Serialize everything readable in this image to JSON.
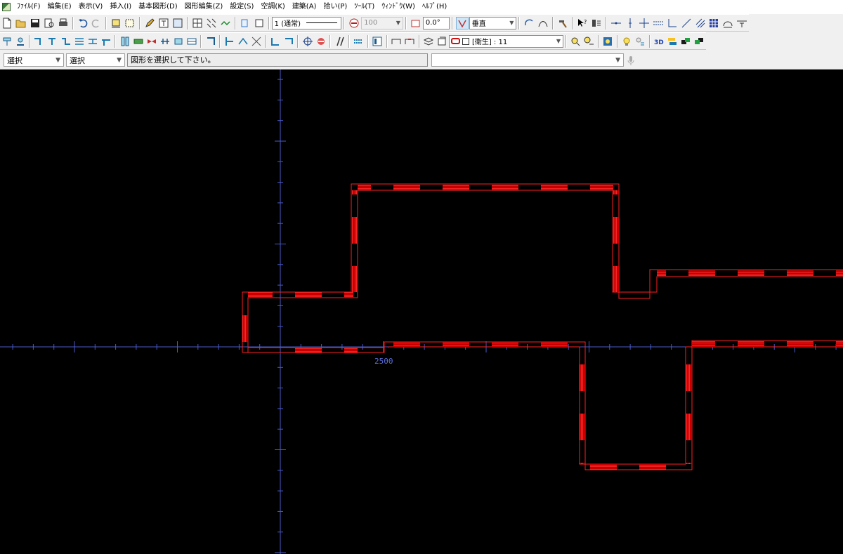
{
  "menubar": {
    "items": [
      "ﾌｧｲﾙ(F)",
      "編集(E)",
      "表示(V)",
      "挿入(I)",
      "基本図形(D)",
      "図形編集(Z)",
      "設定(S)",
      "空調(K)",
      "建築(A)",
      "拾い(P)",
      "ﾂｰﾙ(T)",
      "ｳｨﾝﾄﾞｳ(W)",
      "ﾍﾙﾌﾟ(H)"
    ]
  },
  "toolbar1": {
    "line_type_value": "1 (通常)",
    "line_width_value": "100",
    "angle_value": "0.0°",
    "direction_value": "垂直"
  },
  "toolbar2": {
    "layer_value": "[衛生] : 11"
  },
  "cmdbar": {
    "select1_value": "選択",
    "select2_value": "選択",
    "status_message": "図形を選択して下さい。",
    "input_value": ""
  },
  "canvas": {
    "x_axis_label": "2500",
    "colors": {
      "background": "#000000",
      "axis": "#4a5ac8",
      "drawing": "#e00000"
    }
  }
}
